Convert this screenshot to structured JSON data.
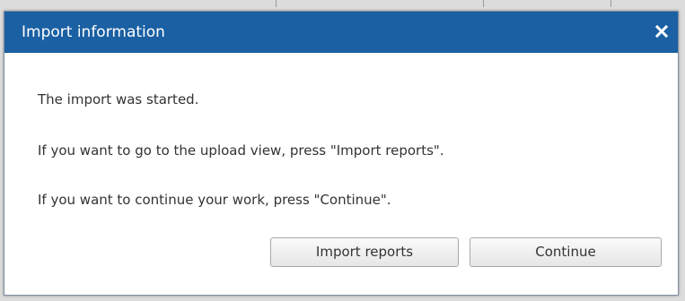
{
  "dialog": {
    "title": "Import information",
    "close_icon": "close-icon",
    "messages": [
      "The import was started.",
      "If you want to go to the upload view, press  \"Import reports\".",
      "If you want to continue your work, press \"Continue\"."
    ],
    "buttons": {
      "import_reports_label": "Import reports",
      "continue_label": "Continue"
    }
  },
  "colors": {
    "titlebar": "#1a60a3",
    "title_text": "#ffffff",
    "body_text": "#333333"
  }
}
